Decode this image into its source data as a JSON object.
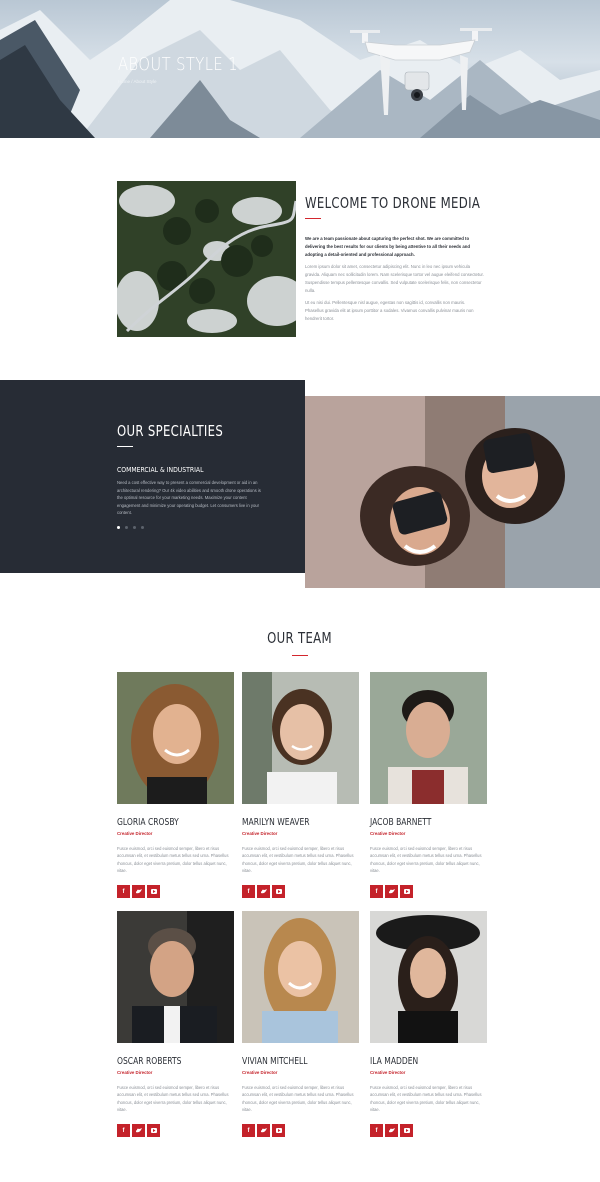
{
  "hero": {
    "title": "ABOUT STYLE 1",
    "breadcrumb": "Home / About Style"
  },
  "welcome": {
    "title": "WELCOME TO DRONE MEDIA",
    "lead": "We are a team passionate about capturing the perfect shot. We are committed to delivering the best results for our clients by being attentive to all their needs and adopting a detail-oriented and professional approach.",
    "paragraph1": "Lorem ipsum dolor sit amet, consectetur adipiscing elit. Nunc in leo nec ipsum vehicula gravida. Aliquam nec sollicitudin lorem. Nam scelerisque tortor vel augue eleifend consectetur. Suspendisse tempus pellentesque convallis. Sed vulputate scelerisque felis, non consectetur nulla.",
    "paragraph2": "Ut eu nisi dui. Pellentesque nisl augue, egestas non sagittis id, convallis non mauris. Phasellus gravida elit at ipsum porttitor a sodales. Vivamus convallis pulvinar mauris non hendrerit tortor."
  },
  "specialties": {
    "title": "OUR SPECIALTIES",
    "subtitle": "COMMERCIAL & INDUSTRIAL",
    "text": "Need a cost effective way to present a commercial development or aid in an architectural rendering? Our 4k video abilities and smooth drone operations is the optimal resource for your marketing needs. Maximize your content engagement and minimize your operating budget. Let consumers live in your content.",
    "slides": 4,
    "active_slide": 1
  },
  "team": {
    "title": "OUR TEAM",
    "members": [
      {
        "name": "GLORIA CROSBY",
        "role": "Creative Director",
        "bio": "Fusce euismod, orci sed euismod semper, libero et risus accumsan elit, et vestibulum metus tellus sed urna. Phasellus rhoncus, dolor eget viverra pretium, dolor tellus aliquet nunc, vitae."
      },
      {
        "name": "MARILYN WEAVER",
        "role": "Creative Director",
        "bio": "Fusce euismod, orci sed euismod semper, libero et risus accumsan elit, et vestibulum metus tellus sed urna. Phasellus rhoncus, dolor eget viverra pretium, dolor tellus aliquet nunc, vitae."
      },
      {
        "name": "JACOB BARNETT",
        "role": "Creative Director",
        "bio": "Fusce euismod, orci sed euismod semper, libero et risus accumsan elit, et vestibulum metus tellus sed urna. Phasellus rhoncus, dolor eget viverra pretium, dolor tellus aliquet nunc, vitae."
      },
      {
        "name": "OSCAR ROBERTS",
        "role": "Creative Director",
        "bio": "Fusce euismod, orci sed euismod semper, libero et risus accumsan elit, et vestibulum metus tellus sed urna. Phasellus rhoncus, dolor eget viverra pretium, dolor tellus aliquet nunc, vitae."
      },
      {
        "name": "VIVIAN MITCHELL",
        "role": "Creative Director",
        "bio": "Fusce euismod, orci sed euismod semper, libero et risus accumsan elit, et vestibulum metus tellus sed urna. Phasellus rhoncus, dolor eget viverra pretium, dolor tellus aliquet nunc, vitae."
      },
      {
        "name": "ILA MADDEN",
        "role": "Creative Director",
        "bio": "Fusce euismod, orci sed euismod semper, libero et risus accumsan elit, et vestibulum metus tellus sed urna. Phasellus rhoncus, dolor eget viverra pretium, dolor tellus aliquet nunc, vitae."
      }
    ],
    "social_icons": [
      "facebook-icon",
      "twitter-icon",
      "youtube-icon"
    ]
  },
  "colors": {
    "accent": "#c4222a",
    "dark_band": "#272c35",
    "heading": "#2b2f36",
    "body_text": "#8a8f96"
  }
}
